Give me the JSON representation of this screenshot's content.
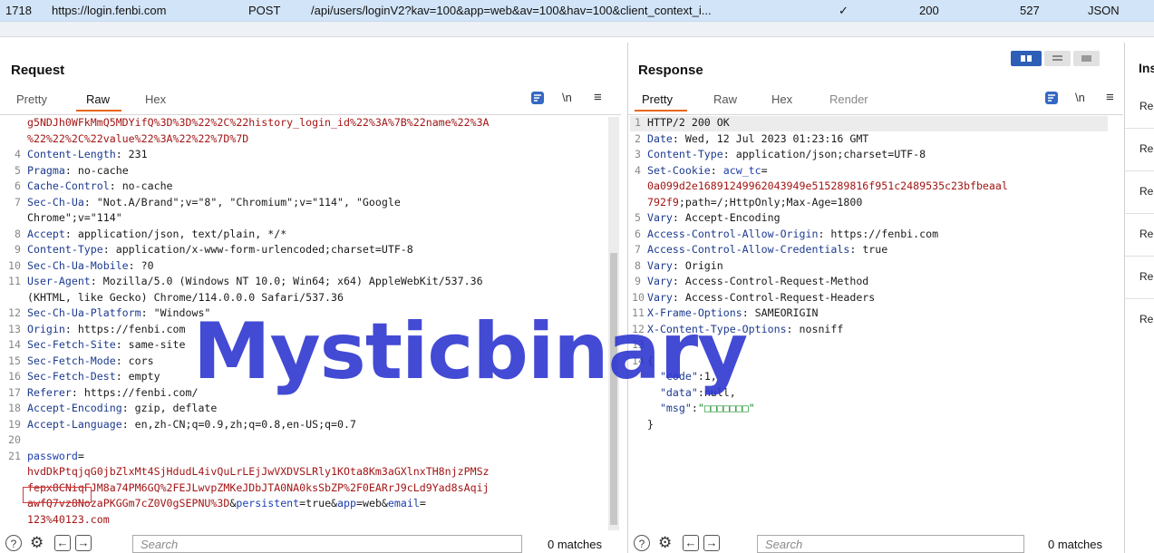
{
  "history_row": {
    "id": "1718",
    "host": "https://login.fenbi.com",
    "method": "POST",
    "url": "/api/users/loginV2?kav=100&app=web&av=100&hav=100&client_context_i...",
    "check": "✓",
    "status": "200",
    "length": "527",
    "mime": "JSON"
  },
  "request": {
    "title": "Request",
    "tabs": [
      "Pretty",
      "Raw",
      "Hex"
    ],
    "active_tab": "Raw",
    "wrap_icon": "wrap-icon",
    "newline_label": "\\n",
    "menu_icon": "≡",
    "search_placeholder": "Search",
    "matches": "0 matches"
  },
  "response": {
    "title": "Response",
    "tabs": [
      "Pretty",
      "Raw",
      "Hex",
      "Render"
    ],
    "active_tab": "Pretty",
    "newline_label": "\\n",
    "menu_icon": "≡",
    "search_placeholder": "Search",
    "matches": "0 matches"
  },
  "inspector": {
    "title": "Ins",
    "rows": [
      "Re",
      "Re",
      "Re",
      "Re",
      "Re",
      "Re"
    ]
  },
  "watermark": "Mysticbinary",
  "colors": {
    "accent": "#e8671b",
    "header_row": "#d2e4f7",
    "watermark": "#2f37d0"
  }
}
